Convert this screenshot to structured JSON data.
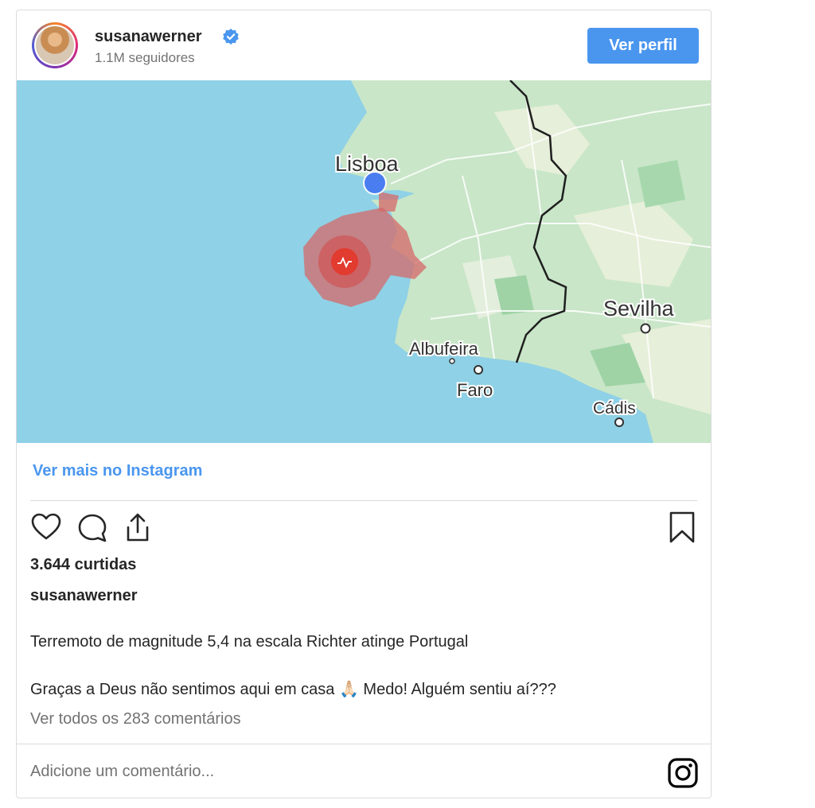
{
  "header": {
    "username": "susanawerner",
    "followers": "1.1M seguidores",
    "profile_button": "Ver perfil",
    "verified_color": "#4a96ef"
  },
  "map": {
    "labels": {
      "lisboa": "Lisboa",
      "sevilha": "Sevilha",
      "albufeira": "Albufeira",
      "faro": "Faro",
      "cadis": "Cádis"
    },
    "colors": {
      "sea": "#8fd1e6",
      "land": "#c9e6c8",
      "epicenter": "#e24c3c",
      "location": "#4a7df0"
    }
  },
  "more_link": "Ver mais no Instagram",
  "icons": [
    "heart-icon",
    "comment-icon",
    "share-icon",
    "bookmark-icon",
    "instagram-icon"
  ],
  "likes": "3.644 curtidas",
  "caption": {
    "username": "susanawerner",
    "line1": "Terremoto de magnitude 5,4 na escala Richter atinge Portugal",
    "line2": "Graças a Deus não sentimos aqui em casa 🙏🏻 Medo! Alguém sentiu aí???"
  },
  "comments_link": "Ver todos os 283 comentários",
  "comment_placeholder": "Adicione um comentário..."
}
